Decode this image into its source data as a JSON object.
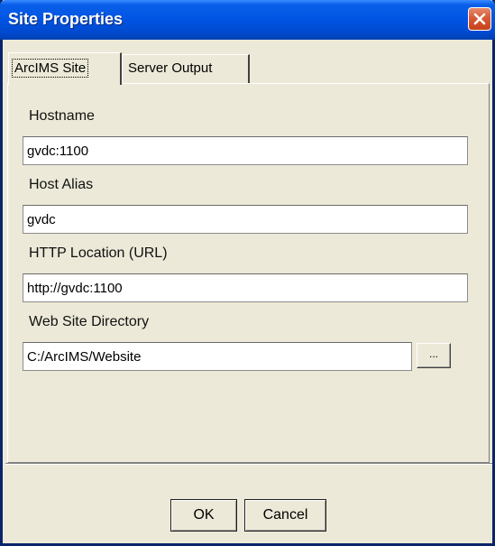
{
  "window": {
    "title": "Site Properties"
  },
  "tabs": [
    {
      "label": "ArcIMS Site"
    },
    {
      "label": "Server Output"
    }
  ],
  "fields": {
    "hostname": {
      "label": "Hostname",
      "value": "gvdc:1100"
    },
    "host_alias": {
      "label": "Host Alias",
      "value": "gvdc"
    },
    "http_location": {
      "label": "HTTP Location (URL)",
      "value": "http://gvdc:1100"
    },
    "web_site_directory": {
      "label": "Web Site Directory",
      "value": "C:/ArcIMS/Website"
    }
  },
  "browse_label": "...",
  "buttons": {
    "ok": "OK",
    "cancel": "Cancel"
  },
  "colors": {
    "titlebar": "#0054e3",
    "dialog_background": "#ece9d8",
    "close_button": "#d75a36"
  },
  "icons": {
    "close": "close-icon"
  }
}
